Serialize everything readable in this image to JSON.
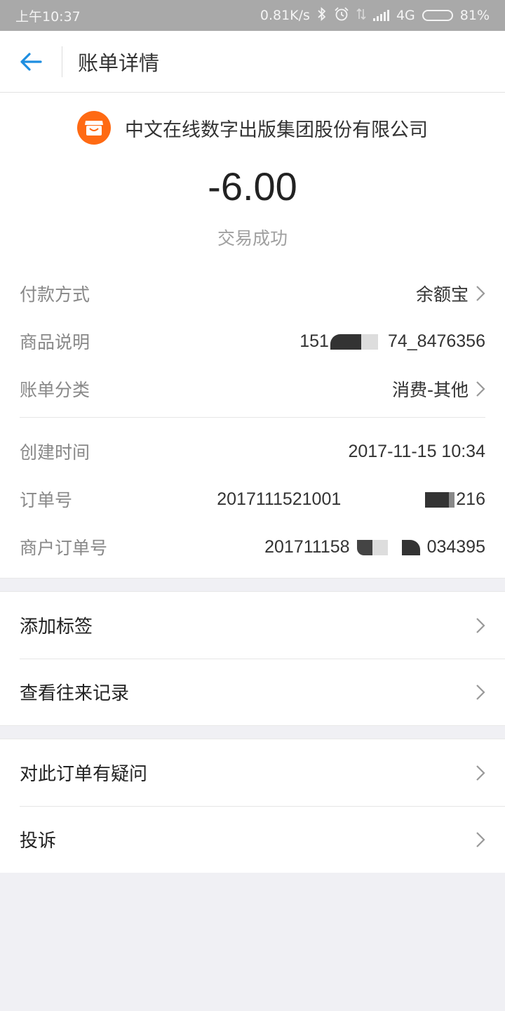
{
  "status_bar": {
    "time": "上午10:37",
    "speed": "0.81K/s",
    "network": "4G",
    "battery": "81%"
  },
  "header": {
    "title": "账单详情"
  },
  "summary": {
    "merchant": "中文在线数字出版集团股份有限公司",
    "amount": "-6.00",
    "status": "交易成功",
    "logo_color": "#ff6a13"
  },
  "details": {
    "payment_method": {
      "label": "付款方式",
      "value": "余额宝"
    },
    "product_desc": {
      "label": "商品说明",
      "value_prefix": "151",
      "value_suffix": "74_8476356"
    },
    "category": {
      "label": "账单分类",
      "value": "消费-其他"
    },
    "created_time": {
      "label": "创建时间",
      "value": "2017-11-15 10:34"
    },
    "order_no": {
      "label": "订单号",
      "value_prefix": "2017111521001",
      "value_suffix": "216"
    },
    "merchant_order_no": {
      "label": "商户订单号",
      "value_prefix": "201711158",
      "value_suffix": "034395"
    }
  },
  "menu1": [
    {
      "label": "添加标签"
    },
    {
      "label": "查看往来记录"
    }
  ],
  "menu2": [
    {
      "label": "对此订单有疑问"
    },
    {
      "label": "投诉"
    }
  ],
  "colors": {
    "accent": "#1e8ee0",
    "background": "#f0f0f4"
  }
}
